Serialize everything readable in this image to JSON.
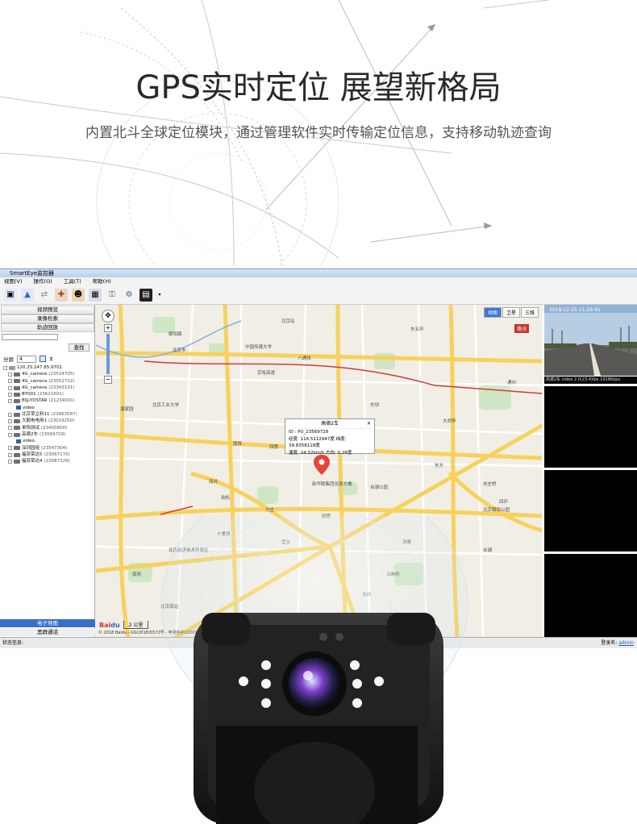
{
  "headline": "GPS实时定位 展望新格局",
  "subheadline": "内置北斗全球定位模块，通过管理软件实时传输定位信息，支持移动轨迹查询",
  "app": {
    "window_title": "SmartEye监控器",
    "menu": [
      "视图(V)",
      "操作(O)",
      "工具(T)",
      "帮助(H)"
    ],
    "left_panel": {
      "buttons": [
        "视频预览",
        "录像检索",
        "轨迹回放"
      ],
      "search_label": "查找",
      "group_label": "分屏",
      "group_value": "4",
      "tree_root": "120.25.247.85:9701",
      "tree_items": [
        {
          "label": "4G_camera",
          "id": "(23524705)"
        },
        {
          "label": "4G_camera",
          "id": "(23552722)"
        },
        {
          "label": "4G_camera",
          "id": "(23343101)"
        },
        {
          "label": "BT001",
          "id": "(23621601)"
        },
        {
          "label": "BSJ-YDSTAR",
          "id": "(21234001)"
        },
        {
          "label": "video",
          "id": ""
        },
        {
          "label": "北京草立利11",
          "id": "(23663587)"
        },
        {
          "label": "大鹤电电用1",
          "id": "(23019250)"
        },
        {
          "label": "单阳测试",
          "id": "(23400800)"
        },
        {
          "label": "高德2车",
          "id": "(23569729)"
        },
        {
          "label": "video",
          "id": ""
        },
        {
          "label": "深圳园组",
          "id": "(23547304)"
        },
        {
          "label": "福奈荣达5",
          "id": "(23067170)"
        },
        {
          "label": "福奈荣达4",
          "id": "(23087329)"
        }
      ],
      "bottom_tabs": [
        "电子地图",
        "黑群通话"
      ]
    },
    "map": {
      "tabs": [
        "地图",
        "卫星",
        "三维"
      ],
      "active_tab": "地图",
      "traffic_label": "路况",
      "popup": {
        "title": "高德2车",
        "id_line": "ID : PU_23569729",
        "coords_line": "经度: 116.5112947度 纬度: 39.8358118度",
        "speed_line": "速度: 24.32km/h 方向: 0.26度"
      },
      "labels": [
        "北京市",
        "朝阳路",
        "中国传媒大学",
        "八通线",
        "北京工业大学",
        "双井",
        "国贸",
        "四惠",
        "劲松",
        "十里河",
        "东坝",
        "潘家园",
        "通州",
        "大郊亭",
        "新华联集团总部大楼",
        "台湖公园",
        "亦庄桥",
        "旧宫",
        "南苑",
        "马驹桥",
        "北京南站",
        "垡头",
        "方庄",
        "大兴",
        "北京经济技术开发区",
        "次渠",
        "台湖",
        "北京朝阳公园",
        "京哈高速",
        "东五环",
        "四环",
        "北京站",
        "东方",
        "马驹桥"
      ],
      "scale_label": "2 公里",
      "copyright": "© 2018 Baidu - GS(2018)5572号 - 甲测资字1100930 - 京ICP证030173号"
    },
    "video_panel": {
      "timestamp": "2018-12-25 11:29:41",
      "caption": "高德2车 video 2.0(23.4)fps 1918Kbps"
    },
    "status": {
      "left": "状态信息:",
      "login_label": "登录名:",
      "user": "admin"
    }
  },
  "colors": {
    "accent": "#3a78d6",
    "map_bg": "#f1eee6",
    "road_yellow": "#f6d25d",
    "marker_red": "#e5463a"
  }
}
